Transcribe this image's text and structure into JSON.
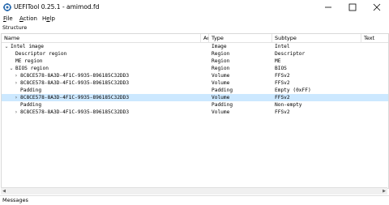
{
  "window": {
    "title": "UEFITool 0.25.1 - amimod.fd"
  },
  "menu": [
    {
      "accel": "F",
      "rest": "ile"
    },
    {
      "accel": "A",
      "rest": "ction"
    },
    {
      "pre": "H",
      "accel": "e",
      "rest": "lp"
    }
  ],
  "structure_label": "Structure",
  "messages_label": "Messages",
  "columns": {
    "name": "Name",
    "action": "Ac",
    "type": "Type",
    "subtype": "Subtype",
    "text": "Text"
  },
  "rows": [
    {
      "name": "Intel image",
      "expander": "expanded",
      "type": "Image",
      "subtype": "Intel"
    },
    {
      "name": "Descriptor region",
      "type": "Region",
      "subtype": "Descriptor"
    },
    {
      "name": "ME region",
      "type": "Region",
      "subtype": "ME"
    },
    {
      "name": "BIOS region",
      "expander": "expanded",
      "type": "Region",
      "subtype": "BIOS"
    },
    {
      "name": "8C8CE578-8A3D-4F1C-9935-896185C32DD3",
      "expander": "collapsed",
      "type": "Volume",
      "subtype": "FFSv2"
    },
    {
      "name": "8C8CE578-8A3D-4F1C-9935-896185C32DD3",
      "expander": "collapsed",
      "type": "Volume",
      "subtype": "FFSv2"
    },
    {
      "name": "Padding",
      "type": "Padding",
      "subtype": "Empty (0xFF)"
    },
    {
      "name": "8C8CE578-8A3D-4F1C-9935-896185C32DD3",
      "expander": "collapsed",
      "type": "Volume",
      "subtype": "FFSv2",
      "selected": true
    },
    {
      "name": "Padding",
      "type": "Padding",
      "subtype": "Non-empty"
    },
    {
      "name": "8C8CE578-8A3D-4F1C-9935-896185C32DD3",
      "expander": "collapsed",
      "type": "Volume",
      "subtype": "FFSv2"
    }
  ],
  "colors": {
    "selection": "#cce8ff",
    "icon_blue": "#2b6cb0"
  }
}
